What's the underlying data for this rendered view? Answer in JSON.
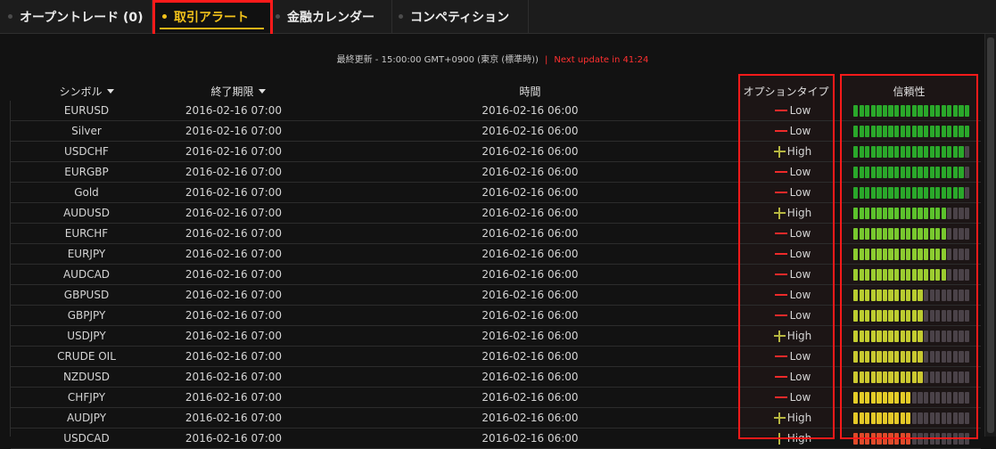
{
  "tabs": [
    {
      "label": "オープントレード (0)",
      "active": false
    },
    {
      "label": "取引アラート",
      "active": true
    },
    {
      "label": "金融カレンダー",
      "active": false
    },
    {
      "label": "コンペティション",
      "active": false
    }
  ],
  "update_bar": {
    "last_update": "最終更新 - 15:00:00 GMT+0900 (東京 (標準時))",
    "separator": "|",
    "next_update": "Next update in 41:24"
  },
  "table": {
    "headers": {
      "symbol": "シンボル",
      "expiry": "終了期限",
      "time": "時間",
      "option_type": "オプションタイプ",
      "reliability": "信頼性"
    },
    "colors": {
      "down": "#ee2a2a",
      "up": "#b6b640",
      "empty_segment": "#4a4248"
    },
    "segments_total": 20,
    "rows": [
      {
        "symbol": "EURUSD",
        "expiry": "2016-02-16 07:00",
        "time": "2016-02-16 06:00",
        "type": "Low",
        "filled": 20,
        "color": "#2aa82a"
      },
      {
        "symbol": "Silver",
        "expiry": "2016-02-16 07:00",
        "time": "2016-02-16 06:00",
        "type": "Low",
        "filled": 20,
        "color": "#2aa82a"
      },
      {
        "symbol": "USDCHF",
        "expiry": "2016-02-16 07:00",
        "time": "2016-02-16 06:00",
        "type": "High",
        "filled": 19,
        "color": "#2aa82a"
      },
      {
        "symbol": "EURGBP",
        "expiry": "2016-02-16 07:00",
        "time": "2016-02-16 06:00",
        "type": "Low",
        "filled": 19,
        "color": "#2aa82a"
      },
      {
        "symbol": "Gold",
        "expiry": "2016-02-16 07:00",
        "time": "2016-02-16 06:00",
        "type": "Low",
        "filled": 19,
        "color": "#2aa82a"
      },
      {
        "symbol": "AUDUSD",
        "expiry": "2016-02-16 07:00",
        "time": "2016-02-16 06:00",
        "type": "High",
        "filled": 16,
        "color": "#5cc22c"
      },
      {
        "symbol": "EURCHF",
        "expiry": "2016-02-16 07:00",
        "time": "2016-02-16 06:00",
        "type": "Low",
        "filled": 16,
        "color": "#78c82e"
      },
      {
        "symbol": "EURJPY",
        "expiry": "2016-02-16 07:00",
        "time": "2016-02-16 06:00",
        "type": "Low",
        "filled": 16,
        "color": "#8ccc30"
      },
      {
        "symbol": "AUDCAD",
        "expiry": "2016-02-16 07:00",
        "time": "2016-02-16 06:00",
        "type": "Low",
        "filled": 16,
        "color": "#9ccc30"
      },
      {
        "symbol": "GBPUSD",
        "expiry": "2016-02-16 07:00",
        "time": "2016-02-16 06:00",
        "type": "Low",
        "filled": 12,
        "color": "#b8cc30"
      },
      {
        "symbol": "GBPJPY",
        "expiry": "2016-02-16 07:00",
        "time": "2016-02-16 06:00",
        "type": "Low",
        "filled": 12,
        "color": "#bccc30"
      },
      {
        "symbol": "USDJPY",
        "expiry": "2016-02-16 07:00",
        "time": "2016-02-16 06:00",
        "type": "High",
        "filled": 12,
        "color": "#c4cc30"
      },
      {
        "symbol": "CRUDE OIL",
        "expiry": "2016-02-16 07:00",
        "time": "2016-02-16 06:00",
        "type": "Low",
        "filled": 12,
        "color": "#c8c830"
      },
      {
        "symbol": "NZDUSD",
        "expiry": "2016-02-16 07:00",
        "time": "2016-02-16 06:00",
        "type": "Low",
        "filled": 12,
        "color": "#ccc830"
      },
      {
        "symbol": "CHFJPY",
        "expiry": "2016-02-16 07:00",
        "time": "2016-02-16 06:00",
        "type": "Low",
        "filled": 10,
        "color": "#e4cc28"
      },
      {
        "symbol": "AUDJPY",
        "expiry": "2016-02-16 07:00",
        "time": "2016-02-16 06:00",
        "type": "High",
        "filled": 10,
        "color": "#e4c828"
      },
      {
        "symbol": "USDCAD",
        "expiry": "2016-02-16 07:00",
        "time": "2016-02-16 06:00",
        "type": "High",
        "filled": 10,
        "color": "#e04a2a"
      }
    ]
  }
}
